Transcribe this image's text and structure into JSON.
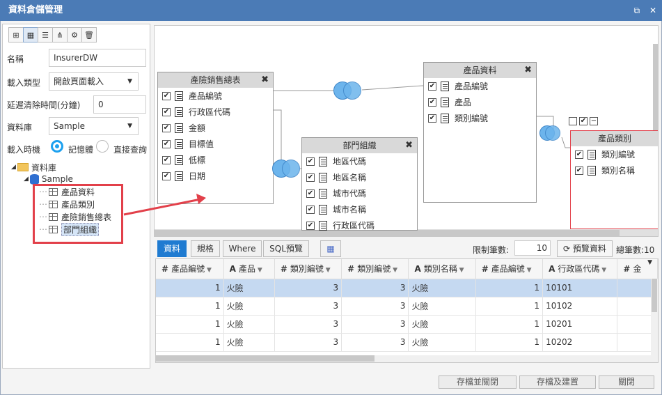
{
  "window": {
    "title": "資料倉儲管理"
  },
  "form": {
    "name_label": "名稱",
    "name_value": "InsurerDW",
    "load_type_label": "載入類型",
    "load_type_value": "開啟頁面載入",
    "delay_label": "延遲清除時間(分鐘)",
    "delay_value": "0",
    "database_label": "資料庫",
    "database_value": "Sample",
    "load_timing_label": "載入時機",
    "option_memory": "記憶體",
    "option_direct": "直接查詢"
  },
  "tree": {
    "root": "資料庫",
    "db": "Sample",
    "tables": [
      "產品資料",
      "產品類別",
      "產險銷售總表",
      "部門組織"
    ]
  },
  "entities": {
    "sales": {
      "title": "產險銷售總表",
      "fields": [
        "產品編號",
        "行政區代碼",
        "金額",
        "目標值",
        "低標",
        "日期"
      ]
    },
    "dept": {
      "title": "部門組織",
      "fields": [
        "地區代碼",
        "地區名稱",
        "城市代碼",
        "城市名稱",
        "行政區代碼"
      ]
    },
    "product": {
      "title": "產品資料",
      "fields": [
        "產品編號",
        "產品",
        "類別編號"
      ]
    },
    "category": {
      "title": "產品類別",
      "fields": [
        "類別編號",
        "類別名稱"
      ]
    }
  },
  "tabs": {
    "data": "資料",
    "spec": "規格",
    "where": "Where",
    "sql": "SQL預覽"
  },
  "controls": {
    "limit_label": "限制筆數:",
    "limit_value": "10",
    "preview_label": "預覽資料",
    "total_label": "總筆數:10"
  },
  "grid": {
    "columns": [
      {
        "icon": "#",
        "name": "產品編號"
      },
      {
        "icon": "A",
        "name": "產品"
      },
      {
        "icon": "#",
        "name": "類別編號"
      },
      {
        "icon": "#",
        "name": "類別編號"
      },
      {
        "icon": "A",
        "name": "類別名稱"
      },
      {
        "icon": "#",
        "name": "產品編號"
      },
      {
        "icon": "A",
        "name": "行政區代碼"
      },
      {
        "icon": "#",
        "name": "金"
      }
    ],
    "rows": [
      [
        "1",
        "火險",
        "3",
        "3",
        "火險",
        "1",
        "10101"
      ],
      [
        "1",
        "火險",
        "3",
        "3",
        "火險",
        "1",
        "10102"
      ],
      [
        "1",
        "火險",
        "3",
        "3",
        "火險",
        "1",
        "10201"
      ],
      [
        "1",
        "火險",
        "3",
        "3",
        "火險",
        "1",
        "10202"
      ]
    ]
  },
  "footer": {
    "save_close": "存檔並關閉",
    "save_build": "存檔及建置",
    "close": "關閉"
  },
  "colors": {
    "titlebar": "#4b7bb6",
    "active_tab": "#1f7bd1",
    "highlight": "#e2404a",
    "selected_row": "#c5d9f1"
  }
}
